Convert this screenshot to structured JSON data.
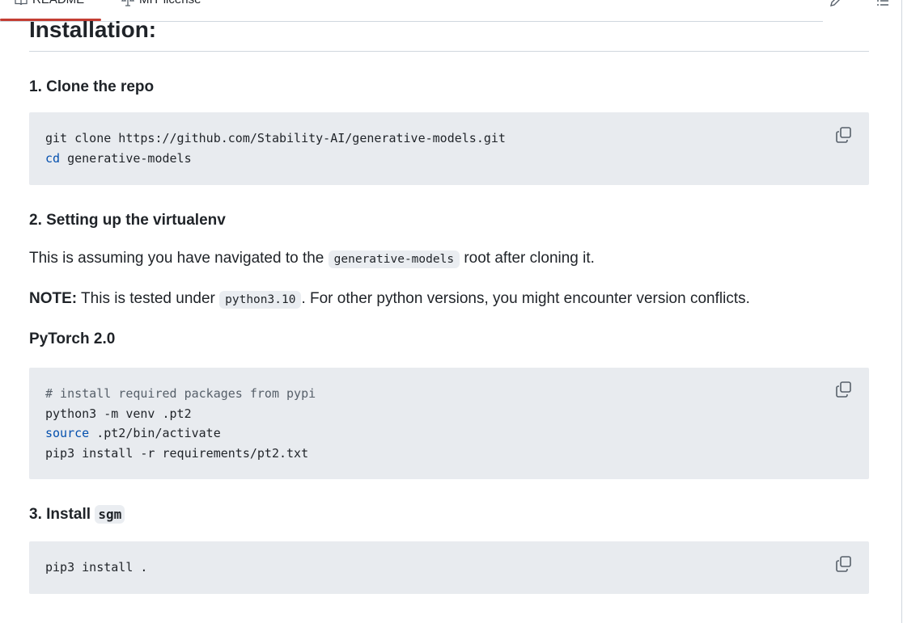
{
  "tabs": [
    {
      "label": "README",
      "icon": "book-icon",
      "active": true
    },
    {
      "label": "MIT license",
      "icon": "law-icon",
      "active": false
    }
  ],
  "colors": {
    "active_tab": "#c43d33",
    "code_bg": "#e8ebef",
    "keyword": "#0550ae",
    "comment": "#57606a"
  },
  "heading": "Installation:",
  "step1": {
    "title": "1. Clone the repo",
    "code": {
      "line1": "git clone https://github.com/Stability-AI/generative-models.git",
      "line2_kw": "cd",
      "line2_rest": " generative-models"
    }
  },
  "step2": {
    "title": "2. Setting up the virtualenv",
    "para1_before": "This is assuming you have navigated to the ",
    "para1_code": "generative-models",
    "para1_after": " root after cloning it.",
    "note_label": "NOTE:",
    "note_before": " This is tested under ",
    "note_code": "python3.10",
    "note_after": ". For other python versions, you might encounter version conflicts."
  },
  "pytorch": {
    "title": "PyTorch 2.0",
    "code": {
      "comment": "# install required packages from pypi",
      "line2": "python3 -m venv .pt2",
      "line3_kw": "source",
      "line3_rest": " .pt2/bin/activate",
      "line4": "pip3 install -r requirements/pt2.txt"
    }
  },
  "step3": {
    "title_text": "3. Install ",
    "title_code": "sgm",
    "code": {
      "line1": "pip3 install ."
    }
  }
}
